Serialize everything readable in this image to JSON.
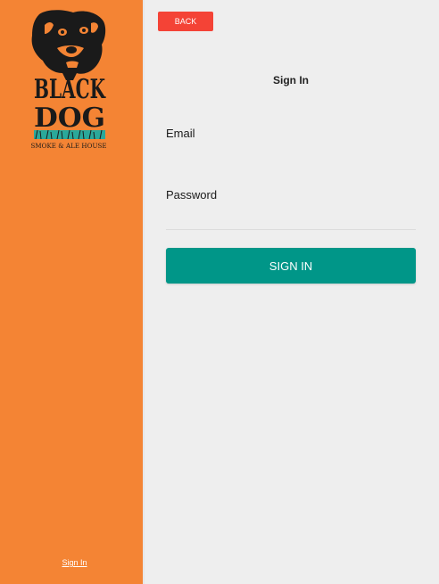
{
  "sidebar": {
    "logo": {
      "brand_letters": "BLACK DOG",
      "subtitle": "SMOKE & ALE HOUSE"
    },
    "signin_link": "Sign In"
  },
  "main": {
    "back_label": "BACK",
    "title": "Sign In",
    "email": {
      "label": "Email",
      "value": ""
    },
    "password": {
      "label": "Password",
      "value": ""
    },
    "submit_label": "SIGN IN"
  },
  "colors": {
    "sidebar": "#f48434",
    "background": "#eeeeee",
    "back_button": "#f44336",
    "primary": "#009688"
  }
}
